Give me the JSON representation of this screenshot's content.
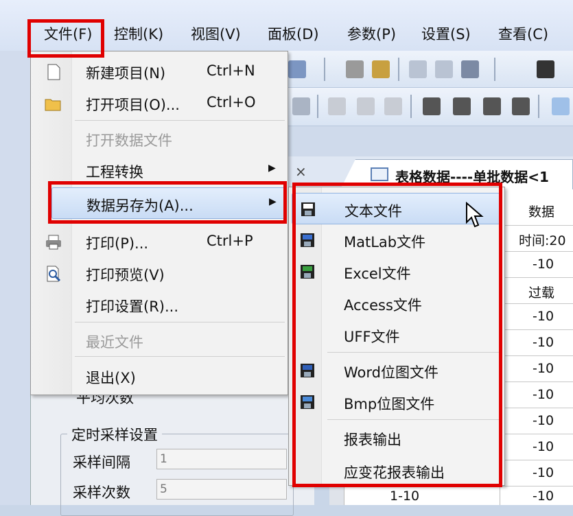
{
  "menubar": [
    "文件(F)",
    "控制(K)",
    "视图(V)",
    "面板(D)",
    "参数(P)",
    "设置(S)",
    "查看(C)"
  ],
  "file_menu": {
    "items": [
      {
        "label": "新建项目(N)",
        "shortcut": "Ctrl+N",
        "icon": "new-document-icon"
      },
      {
        "label": "打开项目(O)...",
        "shortcut": "Ctrl+O",
        "icon": "open-folder-icon"
      },
      {
        "label": "打开数据文件",
        "disabled": true
      },
      {
        "label": "工程转换",
        "submenu": true
      },
      {
        "label": "数据另存为(A)...",
        "submenu": true,
        "highlighted": true
      },
      {
        "label": "打印(P)...",
        "shortcut": "Ctrl+P",
        "icon": "printer-icon"
      },
      {
        "label": "打印预览(V)",
        "icon": "print-preview-icon"
      },
      {
        "label": "打印设置(R)..."
      },
      {
        "label": "最近文件",
        "disabled": true
      },
      {
        "label": "退出(X)"
      }
    ]
  },
  "save_as_submenu": {
    "items": [
      "文本文件",
      "MatLab文件",
      "Excel文件",
      "Access文件",
      "UFF文件",
      "Word位图文件",
      "Bmp位图文件",
      "报表输出",
      "应变花报表输出"
    ]
  },
  "data_tab": {
    "title": "表格数据----单批数据<1",
    "close": "×"
  },
  "table": {
    "header": "数据",
    "cells": [
      "时间:20",
      "-10",
      "过载",
      "-10",
      "-10",
      "-10",
      "-10",
      "-10",
      "-10",
      "-10",
      "-10"
    ],
    "bottom_label": "1-10"
  },
  "left_panel": {
    "partial_label": "平均次数",
    "group_title": "定时采样设置",
    "interval_label": "采样间隔",
    "interval_value": "1",
    "count_label": "采样次数",
    "count_value": "5"
  },
  "colors": {
    "highlight_box": "#e00000",
    "menu_highlight": "#c9dcf5"
  }
}
